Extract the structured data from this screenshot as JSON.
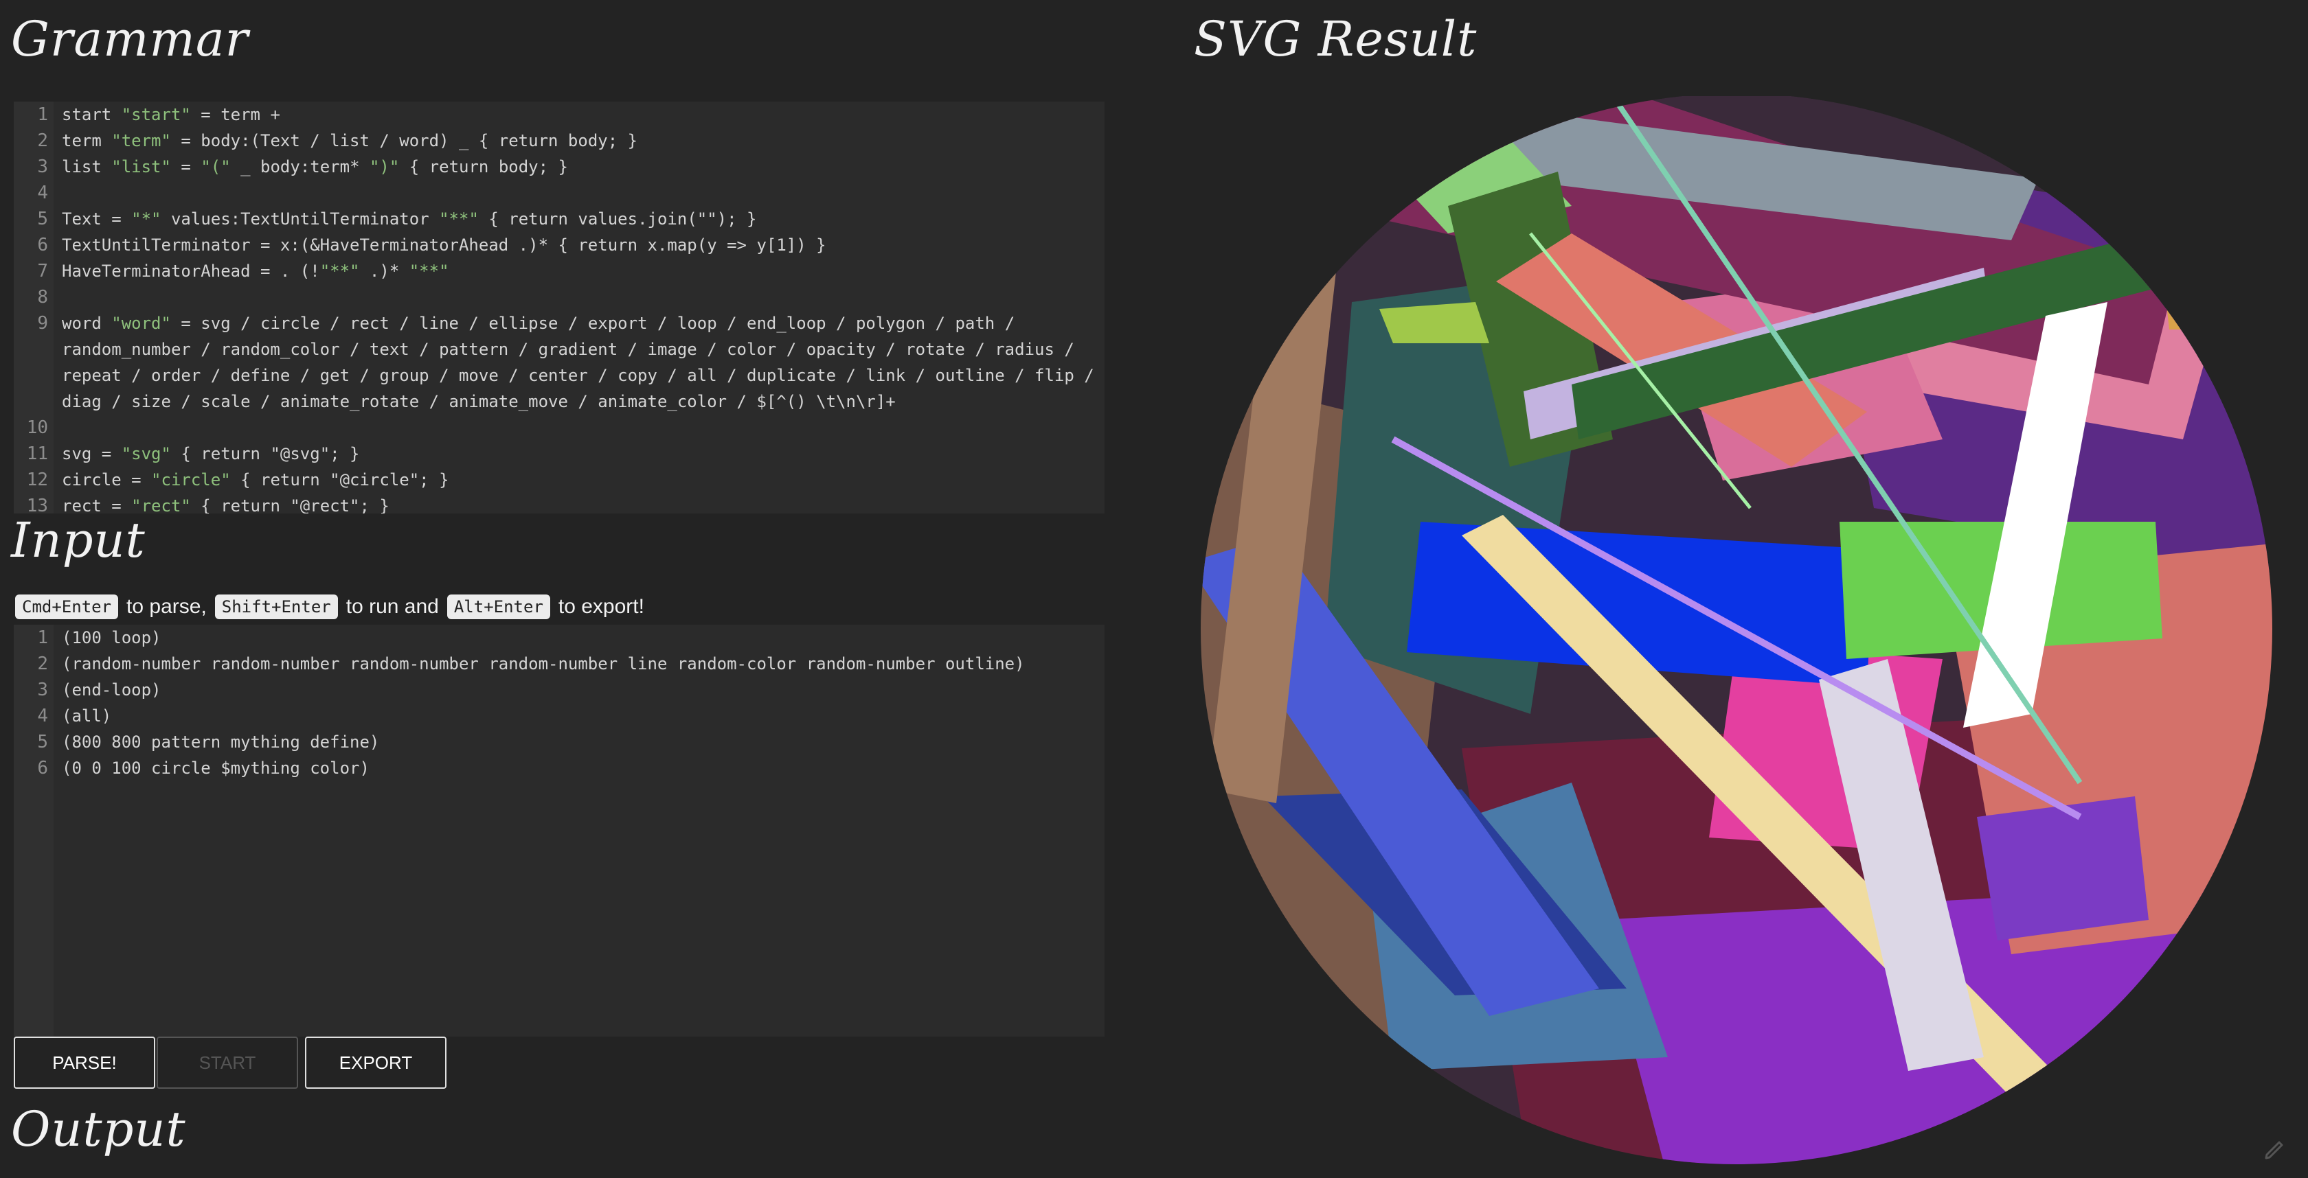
{
  "headings": {
    "grammar": "Grammar",
    "svg_result": "SVG Result",
    "input": "Input",
    "output": "Output"
  },
  "grammar_lines": [
    {
      "n": "1",
      "text": [
        [
          "start ",
          ""
        ],
        [
          "\"start\"",
          "str"
        ],
        [
          " = term +",
          ""
        ]
      ]
    },
    {
      "n": "2",
      "text": [
        [
          "term ",
          ""
        ],
        [
          "\"term\"",
          "str"
        ],
        [
          " = body:(Text / list / word) _ { return body; }",
          ""
        ]
      ]
    },
    {
      "n": "3",
      "text": [
        [
          "list ",
          ""
        ],
        [
          "\"list\"",
          "str"
        ],
        [
          " = ",
          ""
        ],
        [
          "\"(\"",
          "str"
        ],
        [
          " _ body:term* ",
          ""
        ],
        [
          "\")\"",
          "str"
        ],
        [
          " { return body; }",
          ""
        ]
      ]
    },
    {
      "n": "4",
      "text": [
        [
          "",
          ""
        ]
      ]
    },
    {
      "n": "5",
      "text": [
        [
          "Text = ",
          ""
        ],
        [
          "\"*\"",
          "str"
        ],
        [
          " values:TextUntilTerminator ",
          ""
        ],
        [
          "\"**\"",
          "str"
        ],
        [
          " { return values.join(\"\"); }",
          ""
        ]
      ]
    },
    {
      "n": "6",
      "text": [
        [
          "TextUntilTerminator = x:(&HaveTerminatorAhead .)* { return x.map(y => y[1]) }",
          ""
        ]
      ]
    },
    {
      "n": "7",
      "text": [
        [
          "HaveTerminatorAhead = . (!",
          ""
        ],
        [
          "\"**\"",
          "str"
        ],
        [
          " .)* ",
          ""
        ],
        [
          "\"**\"",
          "str"
        ]
      ]
    },
    {
      "n": "8",
      "text": [
        [
          "",
          ""
        ]
      ]
    },
    {
      "n": "9",
      "text": [
        [
          "word ",
          ""
        ],
        [
          "\"word\"",
          "str"
        ],
        [
          " = svg / circle / rect / line / ellipse / export / loop / end_loop / polygon / path / random_number / random_color / text / pattern / gradient / image / color / opacity / rotate / radius / repeat / order / define / get / group / move / center / copy / all / duplicate / link / outline / flip / diag / size / scale / animate_rotate / animate_move / animate_color / $[^() \\t\\n\\r]+",
          ""
        ]
      ]
    },
    {
      "n": "10",
      "text": [
        [
          "",
          ""
        ]
      ]
    },
    {
      "n": "11",
      "text": [
        [
          "svg = ",
          ""
        ],
        [
          "\"svg\"",
          "str"
        ],
        [
          " { return \"@svg\"; }",
          ""
        ]
      ]
    },
    {
      "n": "12",
      "text": [
        [
          "circle = ",
          ""
        ],
        [
          "\"circle\"",
          "str"
        ],
        [
          " { return \"@circle\"; }",
          ""
        ]
      ]
    },
    {
      "n": "13",
      "text": [
        [
          "rect = ",
          ""
        ],
        [
          "\"rect\"",
          "str"
        ],
        [
          " { return \"@rect\"; }",
          ""
        ]
      ]
    }
  ],
  "hint": {
    "key_parse": "Cmd+Enter",
    "text_parse": "to parse,",
    "key_run": "Shift+Enter",
    "text_run": "to run and",
    "key_export": "Alt+Enter",
    "text_export": "to export!"
  },
  "input_lines": [
    {
      "n": "1",
      "text": "(100 loop)"
    },
    {
      "n": "2",
      "text": "(random-number random-number random-number random-number line random-color random-number outline)"
    },
    {
      "n": "3",
      "text": "(end-loop)"
    },
    {
      "n": "4",
      "text": "(all)"
    },
    {
      "n": "5",
      "text": "(800 800 pattern mything define)"
    },
    {
      "n": "6",
      "text": "(0 0 100 circle $mything color)"
    }
  ],
  "buttons": {
    "parse": "PARSE!",
    "start": "START",
    "export": "EXPORT"
  },
  "colors": {
    "background": "#232323",
    "editor_bg": "#2b2b2b",
    "string": "#8ec07c"
  },
  "icons": {
    "corner": "edit-icon"
  }
}
